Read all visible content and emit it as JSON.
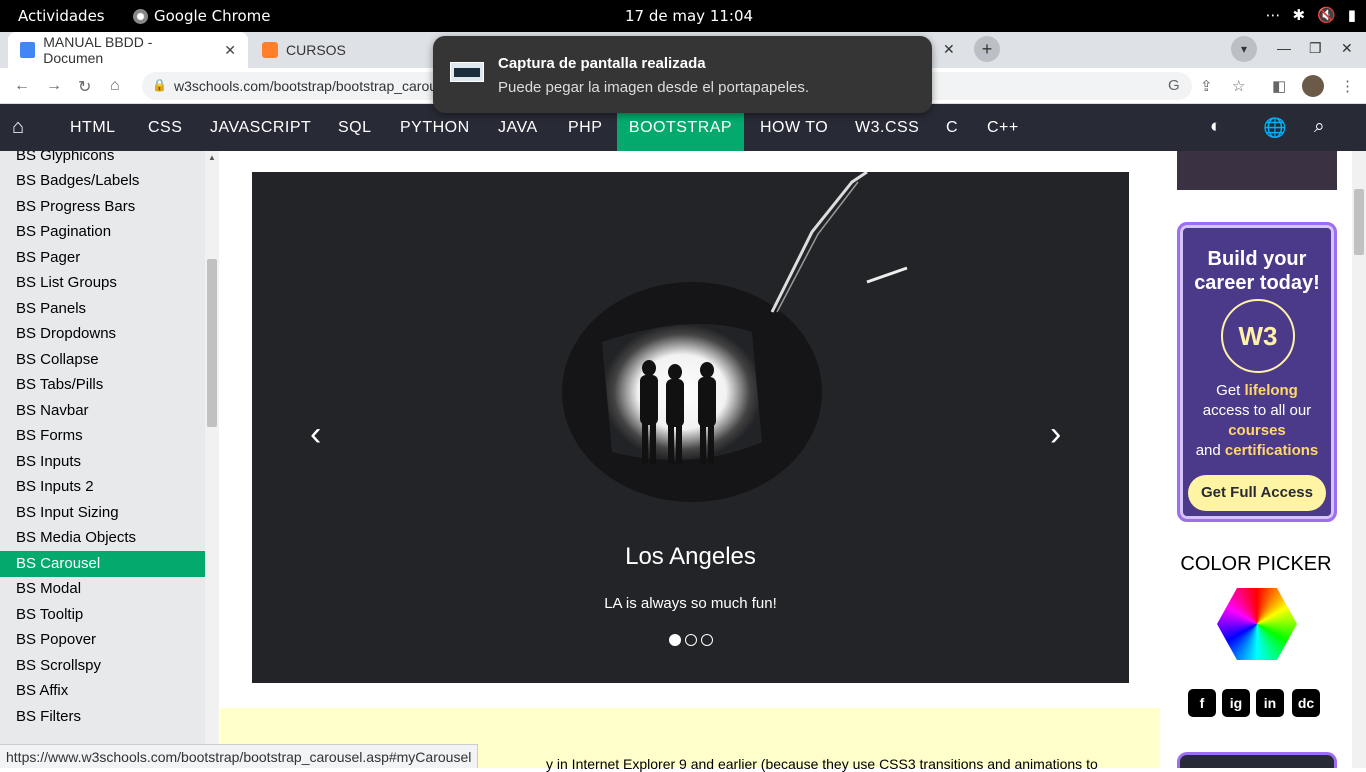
{
  "topbar": {
    "activities": "Actividades",
    "app_name": "Google Chrome",
    "clock": "17 de may  11:04"
  },
  "browser": {
    "tabs": [
      {
        "label": "MANUAL BBDD - Documen",
        "active": true
      },
      {
        "label": "CURSOS",
        "active": false
      }
    ],
    "url": "w3schools.com/bootstrap/bootstrap_carousel.asp",
    "status_url": "https://www.w3schools.com/bootstrap/bootstrap_carousel.asp#myCarousel"
  },
  "notification": {
    "title": "Captura de pantalla realizada",
    "body": "Puede pegar la imagen desde el portapapeles."
  },
  "w3nav": {
    "items": [
      "HTML",
      "CSS",
      "JAVASCRIPT",
      "SQL",
      "PYTHON",
      "JAVA",
      "PHP",
      "BOOTSTRAP",
      "HOW TO",
      "W3.CSS",
      "C",
      "C++"
    ],
    "active": "BOOTSTRAP"
  },
  "sidebar": {
    "items": [
      "BS Glyphicons",
      "BS Badges/Labels",
      "BS Progress Bars",
      "BS Pagination",
      "BS Pager",
      "BS List Groups",
      "BS Panels",
      "BS Dropdowns",
      "BS Collapse",
      "BS Tabs/Pills",
      "BS Navbar",
      "BS Forms",
      "BS Inputs",
      "BS Inputs 2",
      "BS Input Sizing",
      "BS Media Objects",
      "BS Carousel",
      "BS Modal",
      "BS Tooltip",
      "BS Popover",
      "BS Scrollspy",
      "BS Affix",
      "BS Filters"
    ],
    "active": "BS Carousel"
  },
  "carousel": {
    "caption_title": "Los Angeles",
    "caption_text": "LA is always so much fun!",
    "slide_count": 3,
    "active_slide": 1
  },
  "note": {
    "text": "y in Internet Explorer 9 and earlier (because they use CSS3 transitions and animations to"
  },
  "ad": {
    "headline": "Build your career today!",
    "badge_text": "W3",
    "desc_1": "Get ",
    "desc_lifelong": "lifelong",
    "desc_2": "access to all our",
    "desc_courses": "courses",
    "desc_3": "and ",
    "desc_certifications": "certifications",
    "button": "Get Full Access"
  },
  "color_picker_label": "COLOR PICKER",
  "social": [
    "f",
    "ig",
    "in",
    "dc"
  ],
  "colors": {
    "w3_green": "#04aa6d",
    "w3_dark": "#282a35",
    "ad_purple": "#4b3a8a"
  }
}
